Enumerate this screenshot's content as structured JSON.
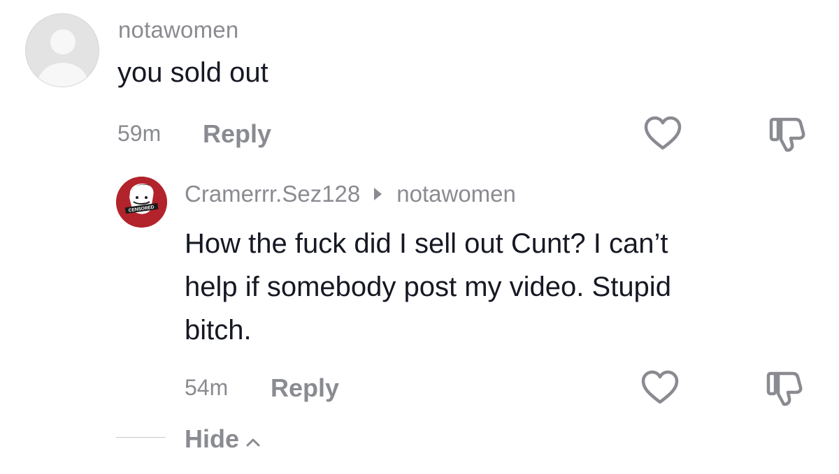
{
  "comments": [
    {
      "username": "notawomen",
      "text": "you sold out",
      "time": "59m",
      "reply_label": "Reply",
      "avatar": "default-avatar-icon"
    }
  ],
  "reply": {
    "username": "Cramerrr.Sez128",
    "reply_to": "notawomen",
    "text_lines": [
      "How the fuck did I sell out Cunt? I can’t",
      "help if somebody post my video. Stupid",
      "bitch."
    ],
    "time": "54m",
    "reply_label": "Reply",
    "avatar_badge": "CENSORED"
  },
  "thread_controls": {
    "hide_label": "Hide"
  },
  "icons": {
    "like": "heart-outline-icon",
    "dislike": "thumbs-down-outline-icon",
    "reply_arrow": "triangle-right-icon",
    "hide_chevron": "chevron-up-icon"
  },
  "colors": {
    "text_primary": "#161823",
    "text_secondary": "#8a8b91",
    "reply_avatar_bg": "#b3232b"
  }
}
